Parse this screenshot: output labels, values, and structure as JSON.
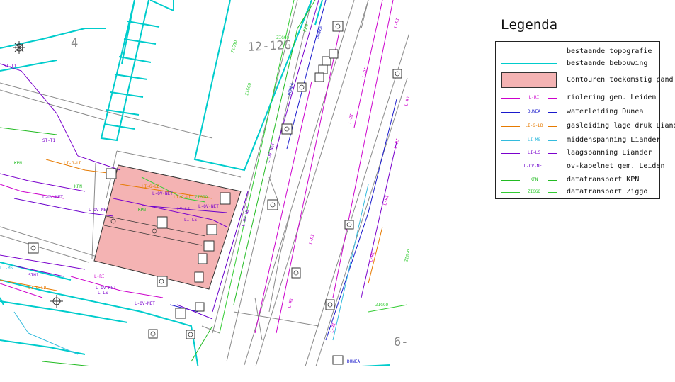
{
  "map": {
    "building_numbers": [
      "4",
      "12-12G",
      "6-"
    ],
    "colors": {
      "topography": "#8a8a8a",
      "buildings": "#00cccc",
      "contour": "#f4b3b3",
      "sewer": "#cc00cc",
      "water": "#1a1acc",
      "gas": "#e67a00",
      "medium_voltage": "#33bbdd",
      "low_voltage": "#7a00cc",
      "street_light": "#6a00cc",
      "kpn": "#22bb22",
      "ziggo": "#33cc33"
    },
    "line_codes": {
      "sewer": "L-RI",
      "water": "DUNEA",
      "gas": "LI-G-LD",
      "medium_voltage": "LI-MS",
      "low_voltage": "LI-LS",
      "street_light": "L-OV-NET",
      "kpn": "KPN",
      "ziggo": "ZIGGO",
      "dunea_alt": "DUNEA",
      "st": "ST-T1",
      "sth": "STH1",
      "gas_lower": "LI-G-LD",
      "ls": "L-LS",
      "rl": "L-RI"
    }
  },
  "legend": {
    "title": "Legenda",
    "items": [
      {
        "label": "bestaande topografie",
        "kind": "thin",
        "color": "#8a8a8a",
        "code": ""
      },
      {
        "label": "bestaande bebouwing",
        "kind": "thick",
        "color": "#00cccc",
        "code": ""
      },
      {
        "label": "Contouren toekomstig pand",
        "kind": "box",
        "color": "#f4b3b3",
        "code": ""
      },
      {
        "label": "riolering gem. Leiden",
        "kind": "coded",
        "color": "#cc00cc",
        "code": "L-RI"
      },
      {
        "label": "waterleiding Dunea",
        "kind": "coded",
        "color": "#1a1acc",
        "code": "DUNEA"
      },
      {
        "label": "gasleiding lage druk Liander",
        "kind": "coded",
        "color": "#e67a00",
        "code": "LI-G-LD"
      },
      {
        "label": "middenspanning Liander",
        "kind": "coded",
        "color": "#33bbdd",
        "code": "LI-MS"
      },
      {
        "label": "laagspanning Liander",
        "kind": "coded",
        "color": "#7a00cc",
        "code": "LI-LS"
      },
      {
        "label": "ov-kabelnet gem. Leiden",
        "kind": "coded",
        "color": "#6a00cc",
        "code": "L-OV-NET"
      },
      {
        "label": "datatransport KPN",
        "kind": "coded",
        "color": "#22bb22",
        "code": "KPN"
      },
      {
        "label": "datatransport Ziggo",
        "kind": "coded",
        "color": "#33cc33",
        "code": "ZIGGO"
      }
    ]
  }
}
